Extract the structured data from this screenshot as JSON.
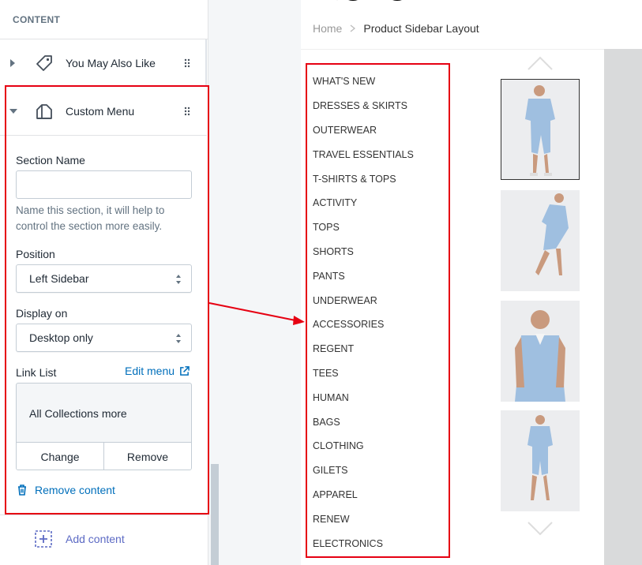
{
  "panel": {
    "header": "CONTENT",
    "sections": [
      {
        "label": "You May Also Like",
        "icon": "tag-icon"
      },
      {
        "label": "Custom Menu",
        "icon": "menu-icon"
      }
    ],
    "section_name_label": "Section Name",
    "section_name_value": "",
    "section_name_help": "Name this section, it will help to control the section more easily.",
    "position_label": "Position",
    "position_value": "Left Sidebar",
    "display_label": "Display on",
    "display_value": "Desktop only",
    "link_list_label": "Link List",
    "edit_menu": "Edit menu",
    "link_list_value": "All Collections more",
    "change_button": "Change",
    "remove_button": "Remove",
    "remove_content": "Remove content",
    "add_content": "Add content"
  },
  "store": {
    "breadcrumb_home": "Home",
    "breadcrumb_current": "Product Sidebar Layout",
    "menu_items": [
      "WHAT'S NEW",
      "DRESSES & SKIRTS",
      "OUTERWEAR",
      "TRAVEL ESSENTIALS",
      "T-SHIRTS & TOPS",
      "ACTIVITY",
      "TOPS",
      "SHORTS",
      "PANTS",
      "UNDERWEAR",
      "ACCESSORIES",
      "REGENT",
      "TEES",
      "HUMAN",
      "BAGS",
      "CLOTHING",
      "GILETS",
      "APPAREL",
      "RENEW",
      "ELECTRONICS"
    ]
  },
  "colors": {
    "highlight": "#e60012",
    "link": "#006fbb",
    "add_link": "#5c6ac4",
    "product_denim": "#9fbfe0"
  }
}
